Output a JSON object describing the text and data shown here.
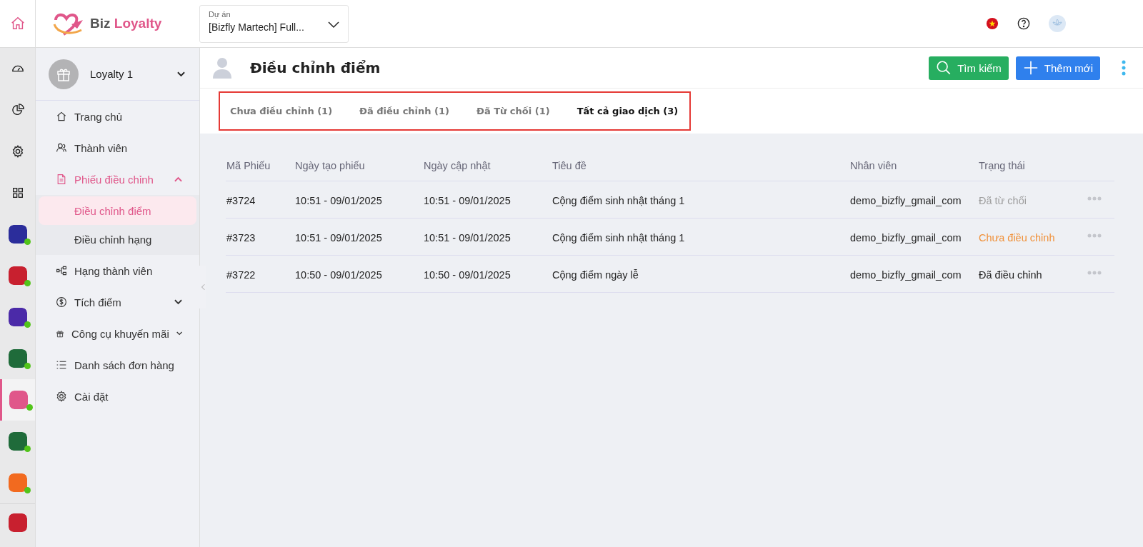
{
  "logo": {
    "part_1": "Biz",
    "part_2": "Loyalty"
  },
  "project": {
    "label": "Dự án",
    "value": "[Bizfly Martech] Full..."
  },
  "rail": {
    "apps": [
      {
        "color": "#2b2d9b",
        "selected": false
      },
      {
        "color": "#c8202f",
        "selected": false
      },
      {
        "color": "#4b2aa8",
        "selected": false
      },
      {
        "color": "#1f6b3a",
        "selected": false
      },
      {
        "color": "#e0578a",
        "selected": true
      },
      {
        "color": "#1f6b3a",
        "selected": false
      },
      {
        "color": "#f26a1f",
        "selected": false
      },
      {
        "color": "#c8202f",
        "selected": false
      }
    ]
  },
  "sidebar": {
    "account": "Loyalty 1",
    "items": [
      {
        "label": "Trang chủ",
        "kind": "link",
        "selected": false
      },
      {
        "label": "Thành viên",
        "kind": "link",
        "selected": false
      },
      {
        "label": "Phiếu điều chỉnh",
        "kind": "group",
        "expanded": true,
        "selected": true,
        "children": [
          {
            "label": "Điều chỉnh điểm",
            "selected": true
          },
          {
            "label": "Điều chỉnh hạng",
            "selected": false
          }
        ]
      },
      {
        "label": "Hạng thành viên",
        "kind": "link",
        "selected": false
      },
      {
        "label": "Tích điểm",
        "kind": "group",
        "expanded": false,
        "selected": false
      },
      {
        "label": "Công cụ khuyến mãi",
        "kind": "group",
        "expanded": false,
        "selected": false
      },
      {
        "label": "Danh sách đơn hàng",
        "kind": "link",
        "selected": false
      },
      {
        "label": "Cài đặt",
        "kind": "link",
        "selected": false
      }
    ]
  },
  "page": {
    "title": "Điều chỉnh điểm",
    "buttons": [
      {
        "label": "Tìm kiếm",
        "kind": "search"
      },
      {
        "label": "Thêm mới",
        "kind": "add"
      }
    ]
  },
  "tabs": [
    {
      "label": "Chưa điều chỉnh (1)",
      "selected": false
    },
    {
      "label": "Đã điều chỉnh (1)",
      "selected": false
    },
    {
      "label": "Đã Từ chối (1)",
      "selected": false
    },
    {
      "label": "Tất cả giao dịch (3)",
      "selected": true
    }
  ],
  "table": {
    "columns": [
      "Mã Phiếu",
      "Ngày tạo phiếu",
      "Ngày cập nhật",
      "Tiêu đề",
      "Nhân viên",
      "Trạng thái"
    ],
    "rows": [
      {
        "cells": [
          "#3724",
          "10:51 - 09/01/2025",
          "10:51 - 09/01/2025",
          "Cộng điểm sinh nhật tháng 1",
          "demo_bizfly_gmail_com"
        ],
        "status": "Đã từ chối",
        "color": "#9e9e9e"
      },
      {
        "cells": [
          "#3723",
          "10:51 - 09/01/2025",
          "10:51 - 09/01/2025",
          "Cộng điểm sinh nhật tháng 1",
          "demo_bizfly_gmail_com"
        ],
        "status": "Chưa điều chỉnh",
        "color": "#f0913a"
      },
      {
        "cells": [
          "#3722",
          "10:50 - 09/01/2025",
          "10:50 - 09/01/2025",
          "Cộng điểm ngày lễ",
          "demo_bizfly_gmail_com"
        ],
        "status": "Đã điều chỉnh",
        "color": "#222222"
      }
    ]
  }
}
